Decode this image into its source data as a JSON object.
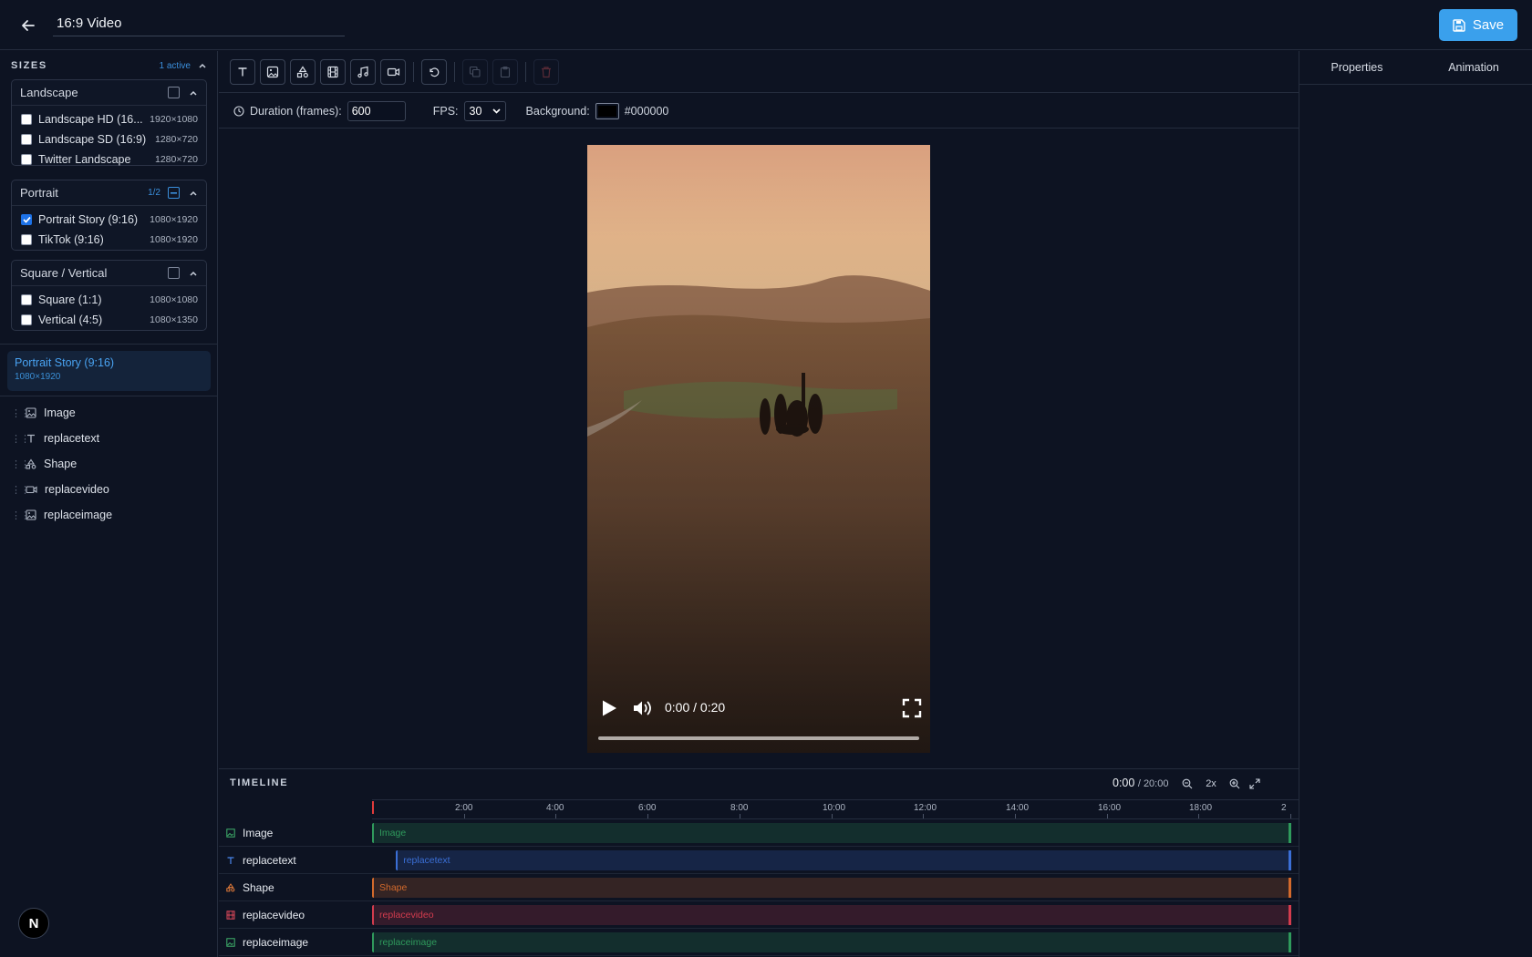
{
  "header": {
    "title_value": "16:9 Video",
    "save_label": "Save"
  },
  "sizes": {
    "title": "SIZES",
    "active_count": "1 active",
    "groups": [
      {
        "name": "Landscape",
        "count": "",
        "items": [
          {
            "label": "Landscape HD (16...",
            "dims": "1920×1080",
            "checked": false
          },
          {
            "label": "Landscape SD (16:9)",
            "dims": "1280×720",
            "checked": false
          },
          {
            "label": "Twitter Landscape",
            "dims": "1280×720",
            "checked": false
          }
        ]
      },
      {
        "name": "Portrait",
        "count": "1/2",
        "items": [
          {
            "label": "Portrait Story (9:16)",
            "dims": "1080×1920",
            "checked": true
          },
          {
            "label": "TikTok (9:16)",
            "dims": "1080×1920",
            "checked": false
          }
        ]
      },
      {
        "name": "Square / Vertical",
        "count": "",
        "items": [
          {
            "label": "Square (1:1)",
            "dims": "1080×1080",
            "checked": false
          },
          {
            "label": "Vertical (4:5)",
            "dims": "1080×1350",
            "checked": false
          }
        ]
      }
    ],
    "active": {
      "name": "Portrait Story (9:16)",
      "dims": "1080×1920"
    }
  },
  "layers": [
    {
      "label": "Image",
      "icon": "image-icon"
    },
    {
      "label": "replacetext",
      "icon": "text-icon"
    },
    {
      "label": "Shape",
      "icon": "shapes-icon"
    },
    {
      "label": "replacevideo",
      "icon": "video-icon"
    },
    {
      "label": "replaceimage",
      "icon": "image-icon"
    }
  ],
  "settings": {
    "duration_label": "Duration (frames):",
    "duration_value": "600",
    "fps_label": "FPS:",
    "fps_value": "30",
    "background_label": "Background:",
    "background_value": "#000000"
  },
  "right_panel": {
    "tabs": [
      "Properties",
      "Animation"
    ]
  },
  "player": {
    "time": "0:00 / 0:20",
    "progress": 0
  },
  "timeline": {
    "title": "TIMELINE",
    "current": "0:00",
    "total": "/ 20:00",
    "zoom": "2x",
    "ticks": [
      "2:00",
      "4:00",
      "6:00",
      "8:00",
      "10:00",
      "12:00",
      "14:00",
      "16:00",
      "18:00",
      "2"
    ],
    "tracks": [
      {
        "name": "Image",
        "clip_label": "Image",
        "color": "#2f9a5c",
        "start": 0.0,
        "end": 1.0
      },
      {
        "name": "replacetext",
        "clip_label": "replacetext",
        "color": "#3b6fd6",
        "start": 0.026,
        "end": 1.0
      },
      {
        "name": "Shape",
        "clip_label": "Shape",
        "color": "#d36a2c",
        "start": 0.0,
        "end": 1.0
      },
      {
        "name": "replacevideo",
        "clip_label": "replacevideo",
        "color": "#d33c4e",
        "start": 0.0,
        "end": 1.0
      },
      {
        "name": "replaceimage",
        "clip_label": "replaceimage",
        "color": "#2f9a5c",
        "start": 0.0,
        "end": 1.0
      }
    ]
  },
  "colors": {
    "accent": "#3aa0ec",
    "background": "#0d1322"
  }
}
